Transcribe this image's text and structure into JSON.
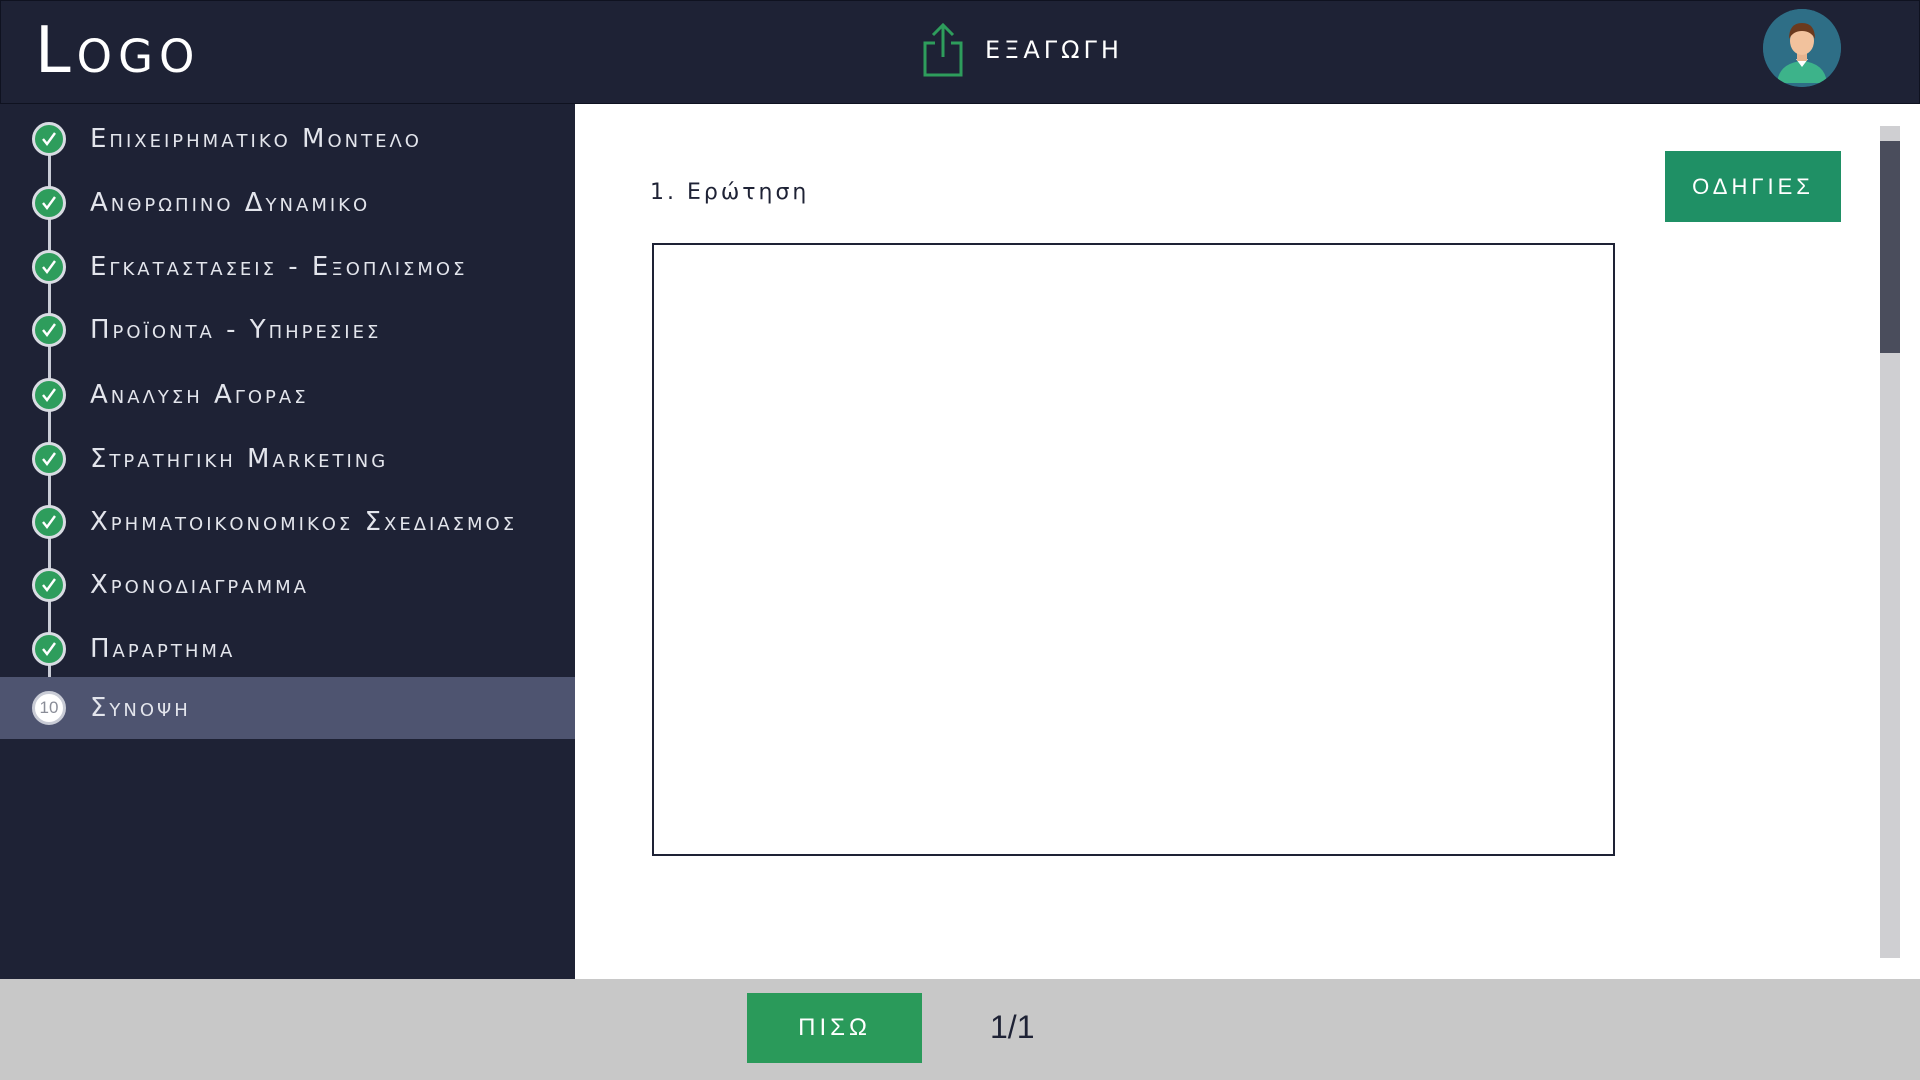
{
  "header": {
    "logo_text": "Logo",
    "export_label": "ΕΞΑΓΩΓΗ",
    "export_icon": "share-export-icon",
    "avatar_icon": "user-avatar"
  },
  "sidebar": {
    "items": [
      {
        "label": "Επιχειρηματικο Μοντελο",
        "status": "complete"
      },
      {
        "label": "Ανθρωπινο Δυναμικο",
        "status": "complete"
      },
      {
        "label": "Εγκαταστασεις - Εξοπλισμος",
        "status": "complete"
      },
      {
        "label": "Προϊοντα - Υπηρεσιες",
        "status": "complete"
      },
      {
        "label": "Αναλυση Αγορας",
        "status": "complete"
      },
      {
        "label": "Στρατηγικη Marketing",
        "status": "complete"
      },
      {
        "label": "Χρηματοικονομικος Σχεδιασμος",
        "status": "complete"
      },
      {
        "label": "Χρονοδιαγραμμα",
        "status": "complete"
      },
      {
        "label": "Παραρτημα",
        "status": "complete"
      },
      {
        "label": "Συνοψη",
        "status": "current",
        "number": "10"
      }
    ]
  },
  "main": {
    "question_label": "1. Ερώτηση",
    "answer_value": "",
    "instructions_label": "ΟΔΗΓΙΕΣ"
  },
  "footer": {
    "back_label": "ΠΙΣΩ",
    "page_indicator": "1/1"
  },
  "colors": {
    "navy": "#1e2235",
    "active_item": "#4e5470",
    "green": "#2a9a5a",
    "teal_button": "#1f9065",
    "footer_gray": "#c8c8c8"
  }
}
